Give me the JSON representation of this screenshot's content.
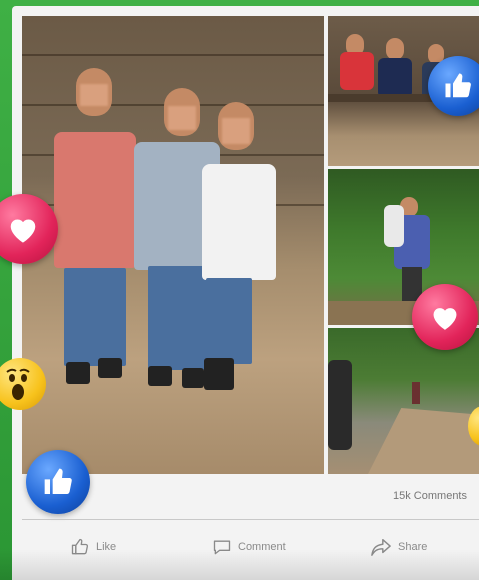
{
  "post": {
    "comments_count": "15k Comments"
  },
  "actions": {
    "like_label": "Like",
    "comment_label": "Comment",
    "share_label": "Share"
  },
  "icons": [
    "like-icon",
    "comment-icon",
    "share-icon",
    "heart-reaction-icon",
    "thumbs-up-reaction-icon",
    "wow-reaction-icon"
  ],
  "colors": {
    "background_green": "#2f9d3a",
    "card": "#f3f3f3",
    "action_text": "#8a8a8a",
    "heart": "#e2245a",
    "like": "#1a5fd1",
    "wow": "#f7c21c"
  }
}
